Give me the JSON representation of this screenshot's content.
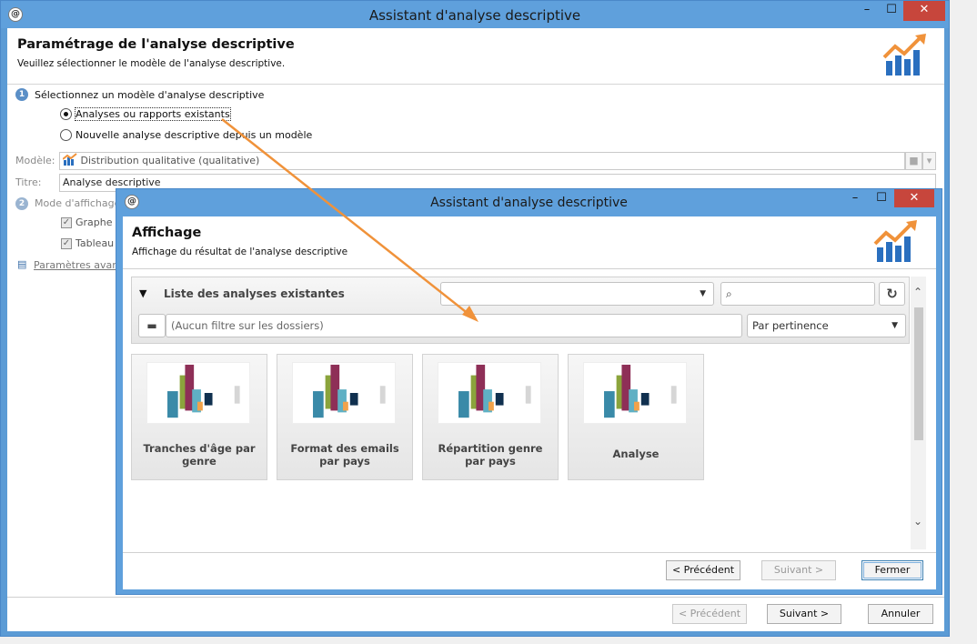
{
  "outer": {
    "app_icon": "@",
    "title": "Assistant d'analyse descriptive",
    "window_controls": {
      "minimize": "–",
      "maximize": "☐",
      "close": "✕"
    },
    "header_title": "Paramétrage de l'analyse descriptive",
    "header_subtitle": "Veuillez sélectionner le modèle de l'analyse descriptive.",
    "step1": {
      "number": "1",
      "label": "Sélectionnez un modèle d'analyse descriptive"
    },
    "radio_existing": "Analyses ou rapports existants",
    "radio_new": "Nouvelle analyse descriptive depuis un modèle",
    "model_label": "Modèle:",
    "model_value": "Distribution qualitative (qualitative)",
    "title_label": "Titre:",
    "title_value": "Analyse descriptive",
    "step2": {
      "number": "2",
      "label": "Mode d'affichage"
    },
    "check_graph": "Graphe",
    "check_table": "Tableau",
    "advanced_link": "Paramètres avancés",
    "buttons": {
      "previous": "< Précédent",
      "next": "Suivant >",
      "cancel": "Annuler"
    }
  },
  "inner": {
    "app_icon": "@",
    "title": "Assistant d'analyse descriptive",
    "window_controls": {
      "minimize": "–",
      "maximize": "☐",
      "close": "✕"
    },
    "header_title": "Affichage",
    "header_subtitle": "Affichage du résultat de l'analyse descriptive",
    "list_title": "Liste des analyses existantes",
    "combo_value": "",
    "search_value": "",
    "folder_filter_placeholder": "(Aucun filtre sur les dossiers)",
    "sort_value": "Par pertinence",
    "tiles": [
      {
        "label": "Tranches d'âge par genre"
      },
      {
        "label": "Format des emails par pays"
      },
      {
        "label": "Répartition genre par pays"
      },
      {
        "label": "Analyse"
      }
    ],
    "buttons": {
      "previous": "< Précédent",
      "next": "Suivant >",
      "close": "Fermer"
    }
  },
  "colors": {
    "titlebar": "#5fa0dc",
    "close": "#c7463c",
    "accent_arrow": "#f0923a"
  }
}
